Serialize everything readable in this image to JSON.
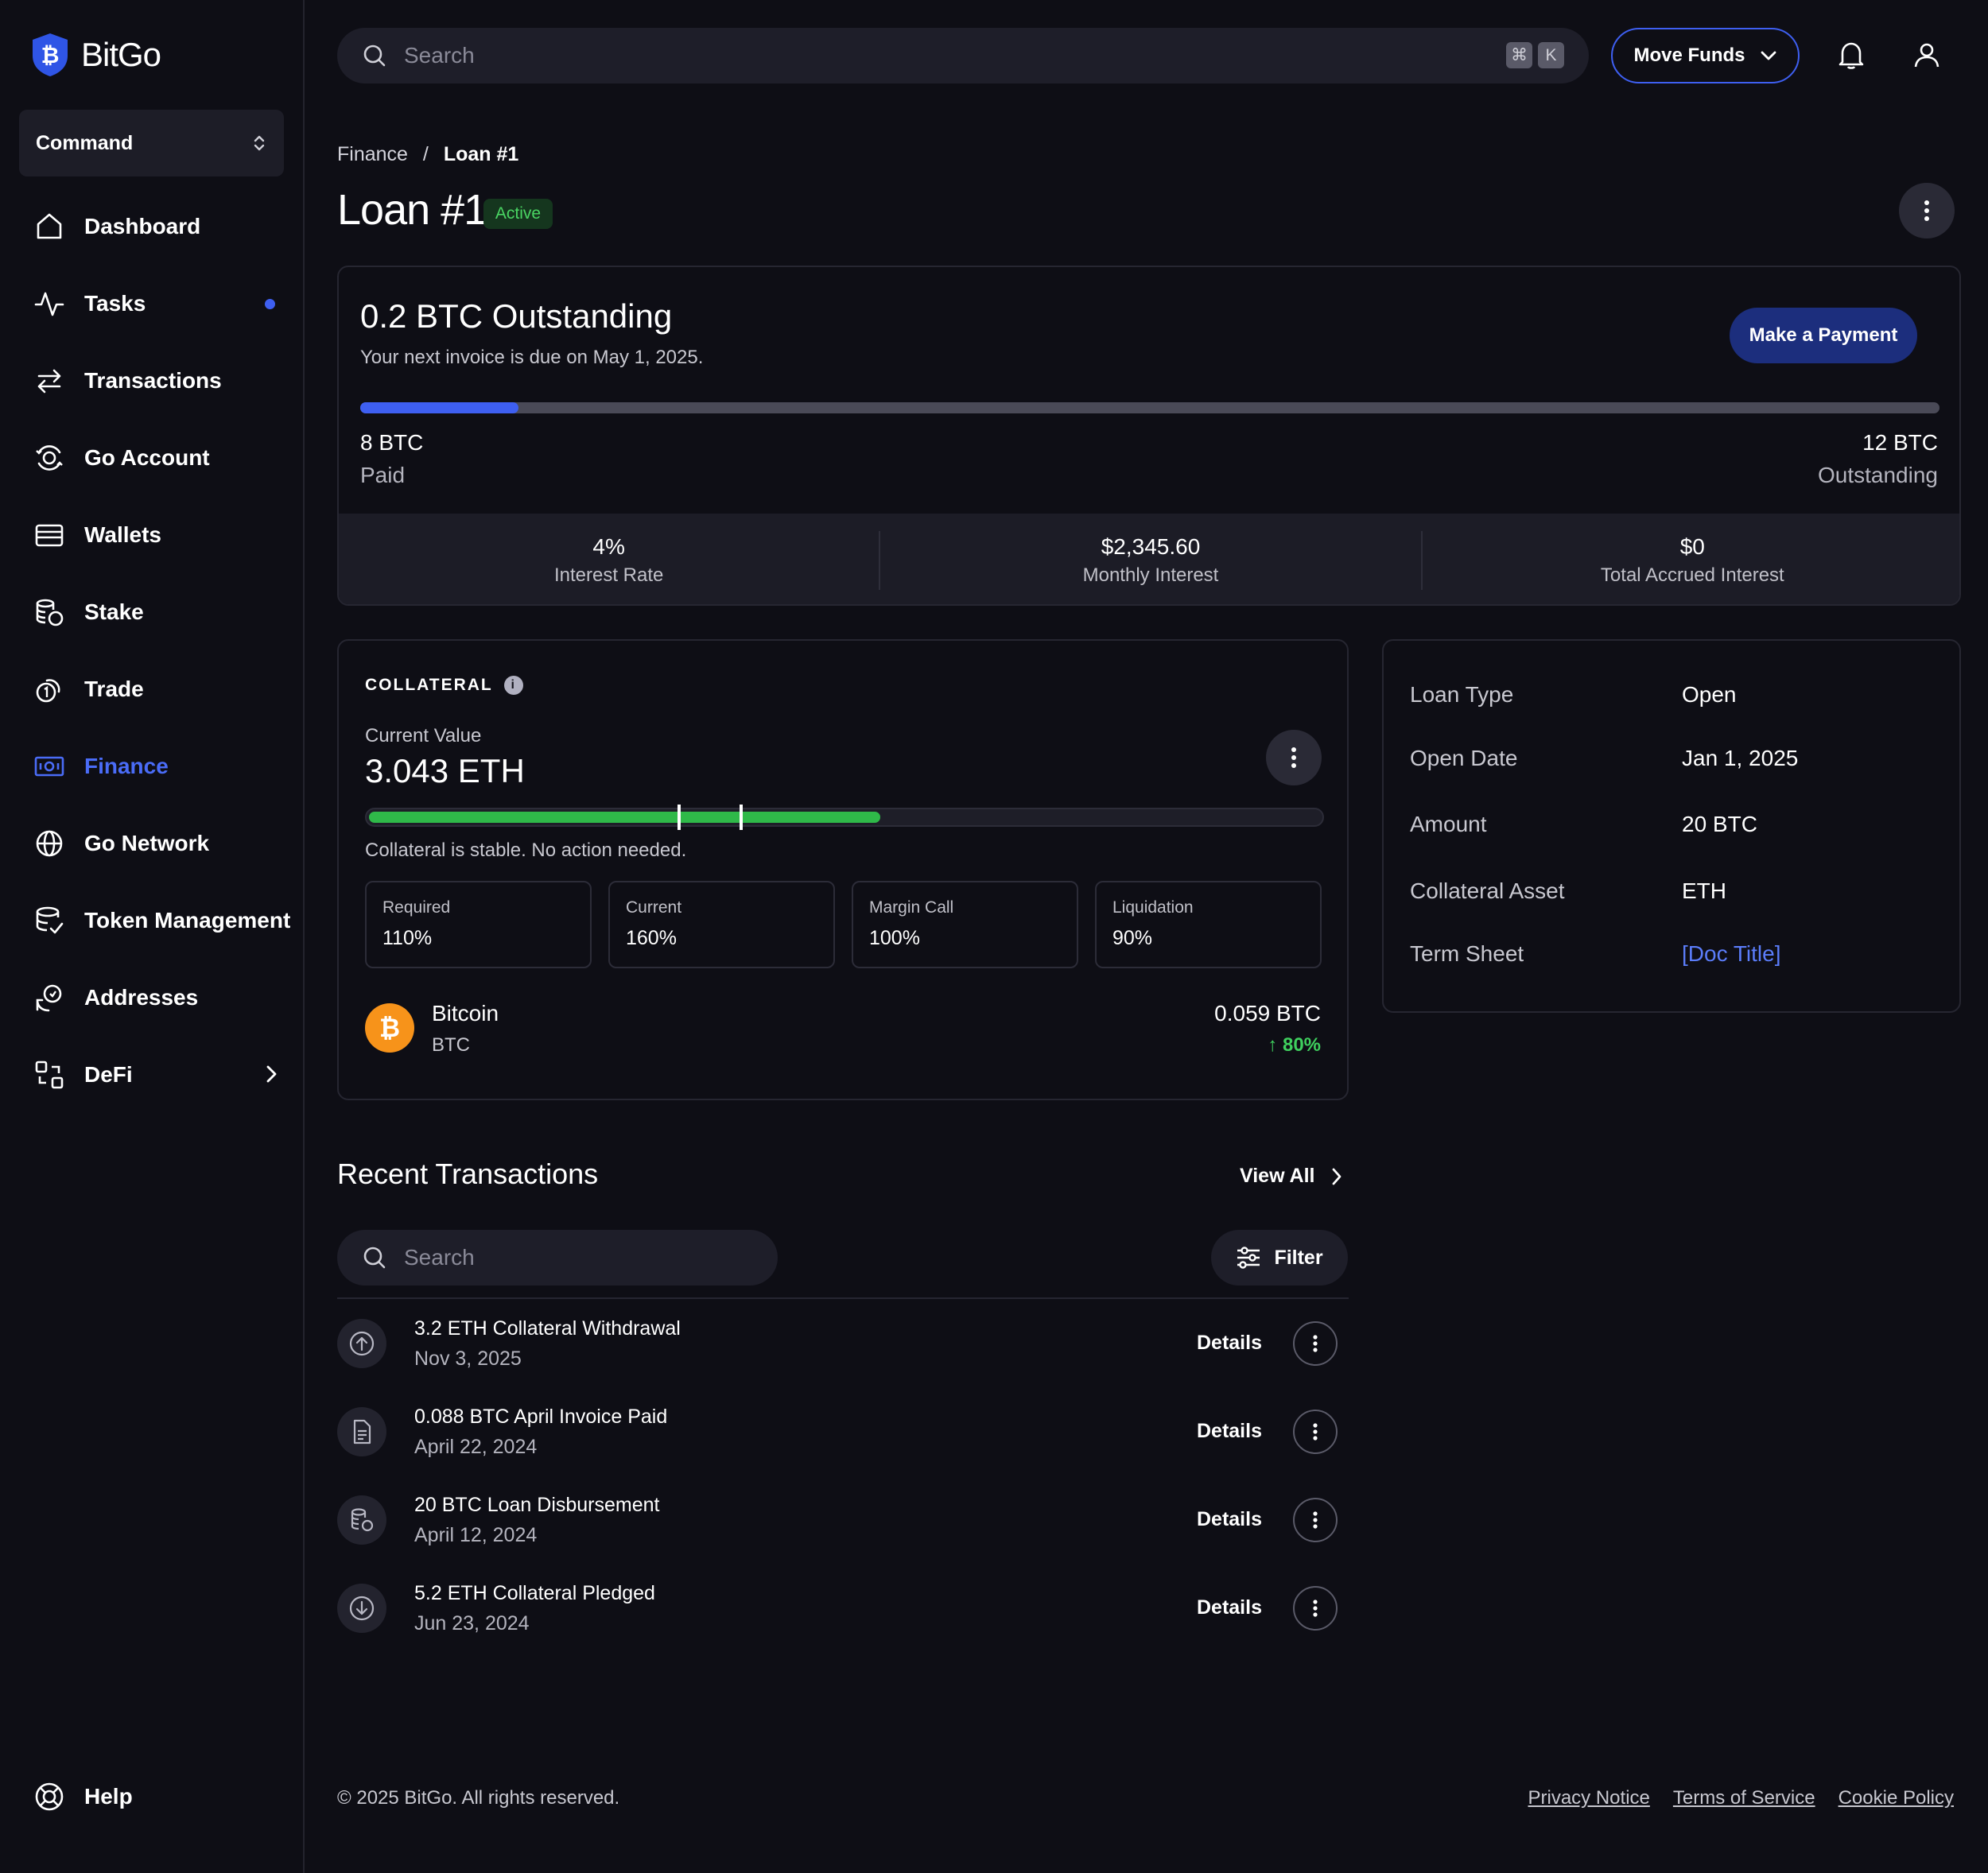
{
  "app": {
    "name": "BitGo"
  },
  "sidebar": {
    "command_label": "Command",
    "items": [
      {
        "label": "Dashboard",
        "icon": "home-icon"
      },
      {
        "label": "Tasks",
        "icon": "activity-icon",
        "has_dot": true
      },
      {
        "label": "Transactions",
        "icon": "arrows-swap-icon"
      },
      {
        "label": "Go Account",
        "icon": "go-account-icon"
      },
      {
        "label": "Wallets",
        "icon": "wallet-icon"
      },
      {
        "label": "Stake",
        "icon": "coins-stack-icon"
      },
      {
        "label": "Trade",
        "icon": "trade-coin-icon"
      },
      {
        "label": "Finance",
        "icon": "finance-icon",
        "active": true
      },
      {
        "label": "Go Network",
        "icon": "globe-icon"
      },
      {
        "label": "Token Management",
        "icon": "token-management-icon"
      },
      {
        "label": "Addresses",
        "icon": "addresses-icon"
      },
      {
        "label": "DeFi",
        "icon": "defi-icon",
        "has_chevron": true
      }
    ],
    "help_label": "Help"
  },
  "header": {
    "search_placeholder": "Search",
    "shortcut_keys": [
      "⌘",
      "K"
    ],
    "move_funds_label": "Move Funds"
  },
  "breadcrumb": {
    "parent": "Finance",
    "separator": "/",
    "current": "Loan #1"
  },
  "page": {
    "title": "Loan #1",
    "status": "Active"
  },
  "outstanding": {
    "headline": "0.2 BTC Outstanding",
    "subtitle": "Your next invoice is due on May 1, 2025.",
    "pay_button": "Make a Payment",
    "progress_fraction": 0.1,
    "paid_value": "8 BTC",
    "paid_label": "Paid",
    "outstanding_value": "12 BTC",
    "outstanding_label": "Outstanding",
    "stats": [
      {
        "value": "4%",
        "label": "Interest Rate"
      },
      {
        "value": "$2,345.60",
        "label": "Monthly Interest"
      },
      {
        "value": "$0",
        "label": "Total Accrued Interest"
      }
    ]
  },
  "collateral": {
    "section_title": "COLLATERAL",
    "current_value_label": "Current Value",
    "current_value": "3.043 ETH",
    "bar_fill_fraction": 0.535,
    "markers_fraction": [
      0.325,
      0.39
    ],
    "status_text": "Collateral is stable. No action needed.",
    "metrics": [
      {
        "label": "Required",
        "value": "110%"
      },
      {
        "label": "Current",
        "value": "160%"
      },
      {
        "label": "Margin Call",
        "value": "100%"
      },
      {
        "label": "Liquidation",
        "value": "90%"
      }
    ],
    "asset": {
      "name": "Bitcoin",
      "ticker": "BTC",
      "amount": "0.059 BTC",
      "change": "↑ 80%"
    }
  },
  "loan_details": [
    {
      "label": "Loan Type",
      "value": "Open"
    },
    {
      "label": "Open Date",
      "value": "Jan 1, 2025"
    },
    {
      "label": "Amount",
      "value": "20 BTC"
    },
    {
      "label": "Collateral Asset",
      "value": "ETH"
    },
    {
      "label": "Term Sheet",
      "value": "[Doc Title]",
      "is_link": true
    }
  ],
  "transactions": {
    "title": "Recent Transactions",
    "view_all": "View All",
    "search_placeholder": "Search",
    "filter_label": "Filter",
    "details_label": "Details",
    "items": [
      {
        "title": "3.2 ETH Collateral Withdrawal",
        "date": "Nov 3, 2025",
        "icon": "upload-circle-icon"
      },
      {
        "title": "0.088 BTC April Invoice Paid",
        "date": "April 22, 2024",
        "icon": "document-icon"
      },
      {
        "title": "20 BTC Loan Disbursement",
        "date": "April 12, 2024",
        "icon": "coins-icon"
      },
      {
        "title": "5.2 ETH Collateral Pledged",
        "date": "Jun 23, 2024",
        "icon": "download-circle-icon"
      }
    ]
  },
  "footer": {
    "copyright": "© 2025 BitGo. All rights reserved.",
    "links": [
      "Privacy Notice",
      "Terms of Service",
      "Cookie Policy"
    ]
  },
  "colors": {
    "accent": "#3e5ff1",
    "success": "#2fb949",
    "background": "#0e0e15",
    "bitcoin": "#f7931a"
  }
}
